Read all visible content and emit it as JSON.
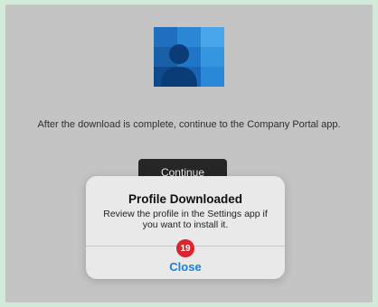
{
  "screen": {
    "info_text": "After the download is complete, continue to the Company Portal app.",
    "continue_label": "Continue"
  },
  "alert": {
    "title": "Profile Downloaded",
    "message": "Review the profile in the Settings app if you want to install it.",
    "close_label": "Close"
  },
  "annotation": {
    "step_number": "19",
    "badge_color": "#d9262c"
  },
  "icons": {
    "app_logo": "company-portal-logo-icon"
  },
  "colors": {
    "page_background": "#d3eadb",
    "screen_background": "#c4c4c4",
    "button_background": "#262626",
    "link_color": "#1a7fe0"
  }
}
